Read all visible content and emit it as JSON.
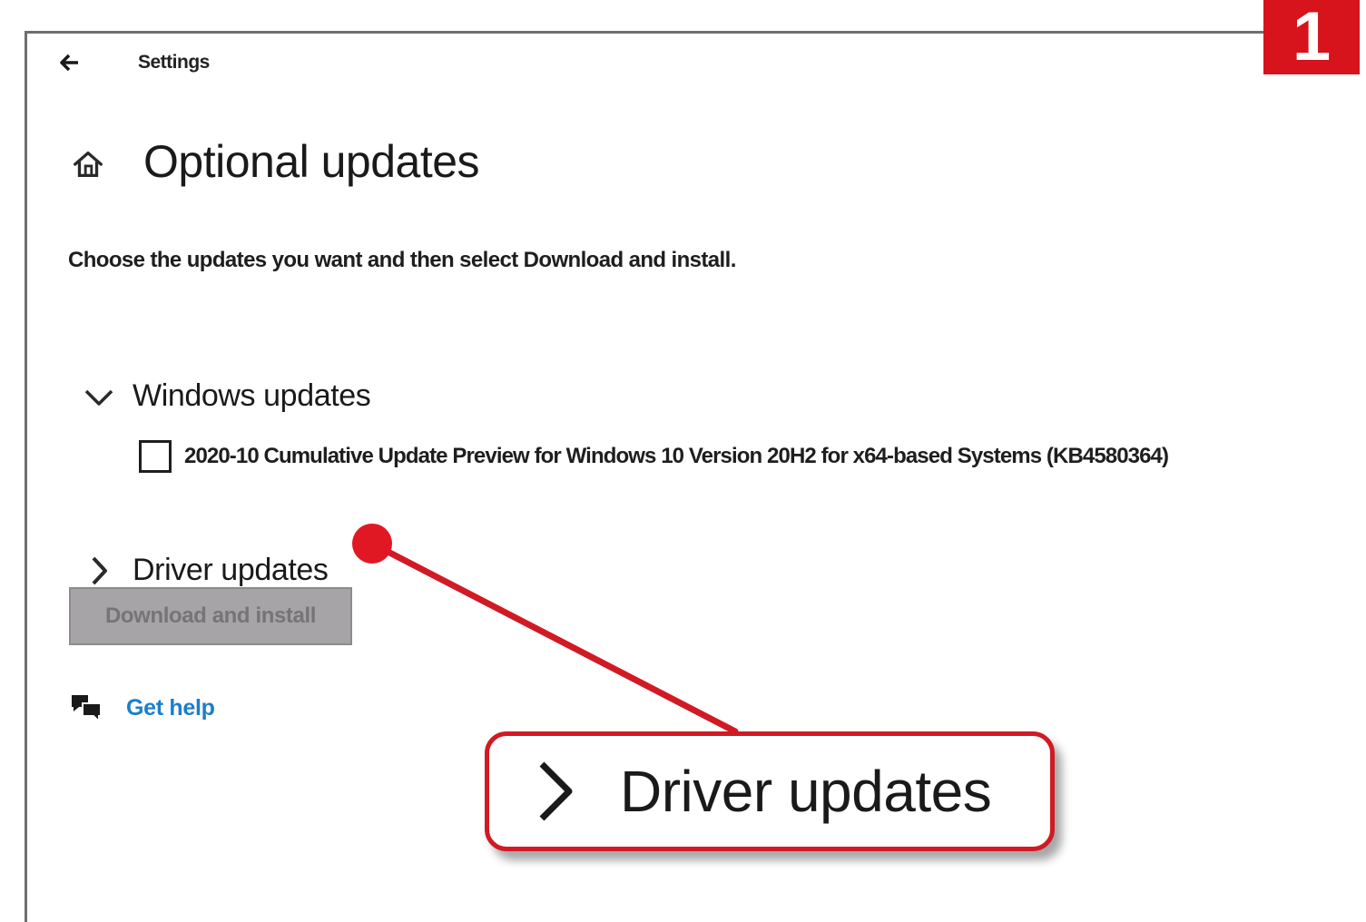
{
  "window": {
    "title": "Settings"
  },
  "page": {
    "title": "Optional updates",
    "description": "Choose the updates you want and then select Download and install."
  },
  "sections": {
    "windows_updates": {
      "label": "Windows updates",
      "expanded": true,
      "items": [
        {
          "label": "2020-10 Cumulative Update Preview for Windows 10 Version 20H2 for x64-based Systems (KB4580364)",
          "checked": false
        }
      ]
    },
    "driver_updates": {
      "label": "Driver updates",
      "expanded": false
    }
  },
  "actions": {
    "download_install_label": "Download and install",
    "download_install_enabled": false
  },
  "help": {
    "link_label": "Get help"
  },
  "annotation": {
    "step_number": "1",
    "callout_label": "Driver updates",
    "accent_color": "#d11a24"
  },
  "icons": {
    "back": "back-arrow-icon",
    "home": "home-icon",
    "expanded_chevron": "chevron-down-icon",
    "collapsed_chevron": "chevron-right-icon",
    "help": "chat-bubbles-icon"
  }
}
